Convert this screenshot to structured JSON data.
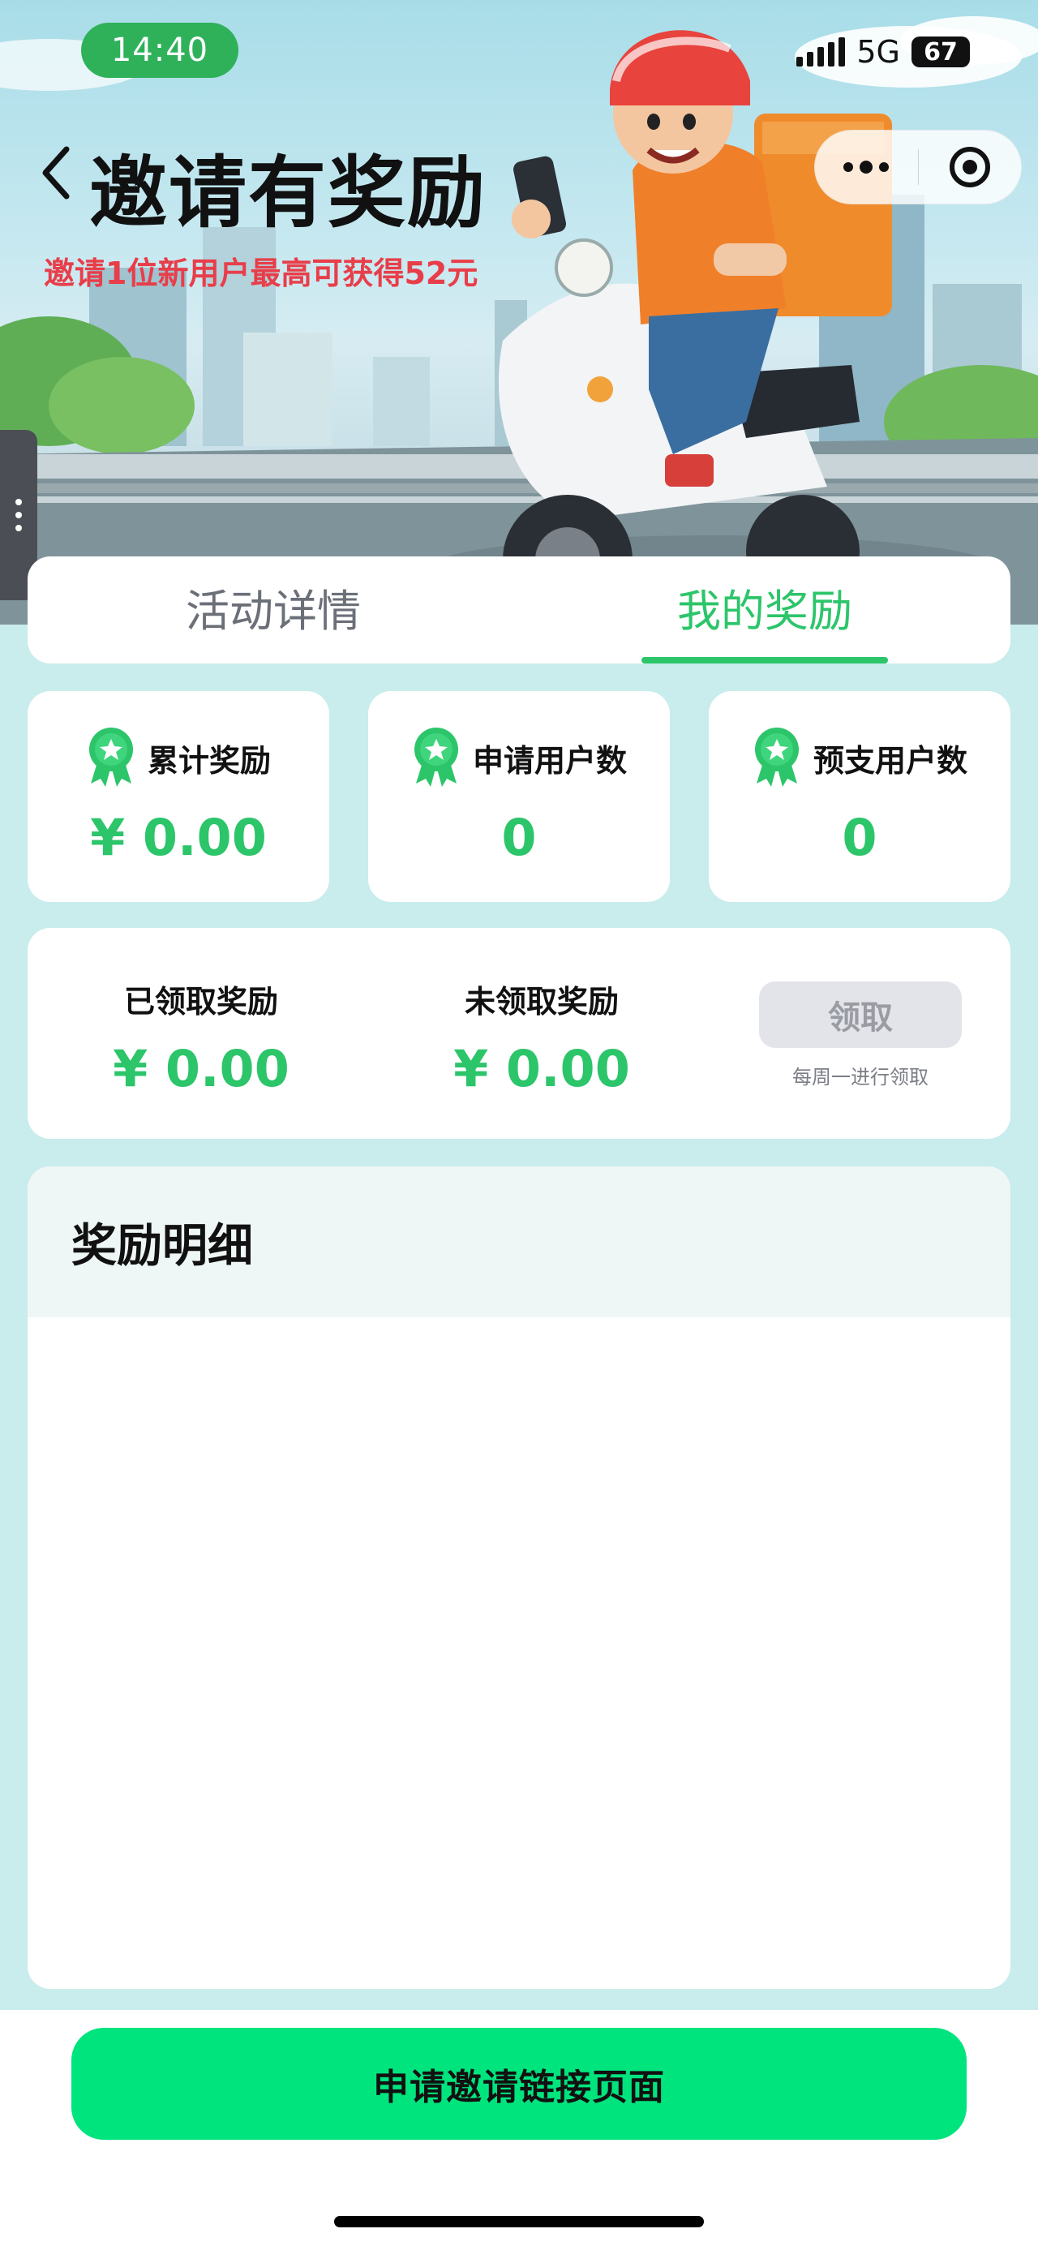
{
  "status_bar": {
    "time": "14:40",
    "network": "5G",
    "battery": "67"
  },
  "header": {
    "title": "邀请有奖励",
    "subtitle": "邀请1位新用户最高可获得52元"
  },
  "tabs": [
    {
      "label": "活动详情",
      "active": false
    },
    {
      "label": "我的奖励",
      "active": true
    }
  ],
  "stats": [
    {
      "label": "累计奖励",
      "value": "¥ 0.00",
      "icon": "award-ribbon-icon"
    },
    {
      "label": "申请用户数",
      "value": "0",
      "icon": "award-ribbon-icon"
    },
    {
      "label": "预支用户数",
      "value": "0",
      "icon": "award-ribbon-icon"
    }
  ],
  "rewards": {
    "claimed_label": "已领取奖励",
    "claimed_value": "¥ 0.00",
    "unclaimed_label": "未领取奖励",
    "unclaimed_value": "¥ 0.00",
    "claim_button": "领取",
    "claim_note": "每周一进行领取"
  },
  "details": {
    "title": "奖励明细"
  },
  "bottom": {
    "apply_button": "申请邀请链接页面"
  },
  "colors": {
    "accent_green": "#2cc56a",
    "cta_green": "#00e47e",
    "subtitle_red": "#e83e4a",
    "page_bg": "#c9ecec"
  }
}
